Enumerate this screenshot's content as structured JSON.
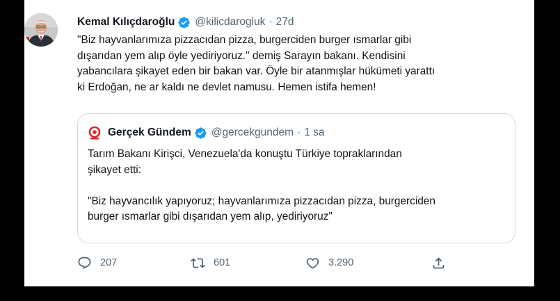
{
  "tweet": {
    "author_name": "Kemal Kılıçdaroğlu",
    "handle": "@kilicdarogluk",
    "separator": "·",
    "time": "27d",
    "text_lines": [
      "\"Biz hayvanlarımıza pizzacıdan pizza, burgerciden burger ısmarlar gibi",
      "dışarıdan yem alıp öyle yediriyoruz.\" demiş Sarayın bakanı. Kendisini",
      "yabancılara şikayet eden bir bakan var. Öyle bir atanmışlar hükümeti yarattı",
      "ki Erdoğan, ne ar kaldı ne devlet namusu. Hemen istifa hemen!"
    ]
  },
  "quote": {
    "author_name": "Gerçek Gündem",
    "handle": "@gercekgundem",
    "separator": "·",
    "time": "1 sa",
    "text_lines": [
      "Tarım Bakanı Kirişci, Venezuela'da konuştu Türkiye topraklarından",
      "şikayet etti:",
      "",
      "\"Biz hayvancılık yapıyoruz; hayvanlarımıza pizzacıdan pizza, burgerciden",
      "burger ısmarlar gibi dışarıdan yem alıp, yediriyoruz\""
    ]
  },
  "actions": {
    "reply_count": "207",
    "retweet_count": "601",
    "like_count": "3.290"
  },
  "icons": {
    "verified": "verified-badge-icon",
    "reply": "reply-icon",
    "retweet": "retweet-icon",
    "like": "heart-icon",
    "share": "share-icon"
  },
  "colors": {
    "verified_blue": "#1d9bf0",
    "text_primary": "#0f1419",
    "text_secondary": "#536471",
    "border": "#cfd9de",
    "quote_logo_red": "#e0262c"
  }
}
